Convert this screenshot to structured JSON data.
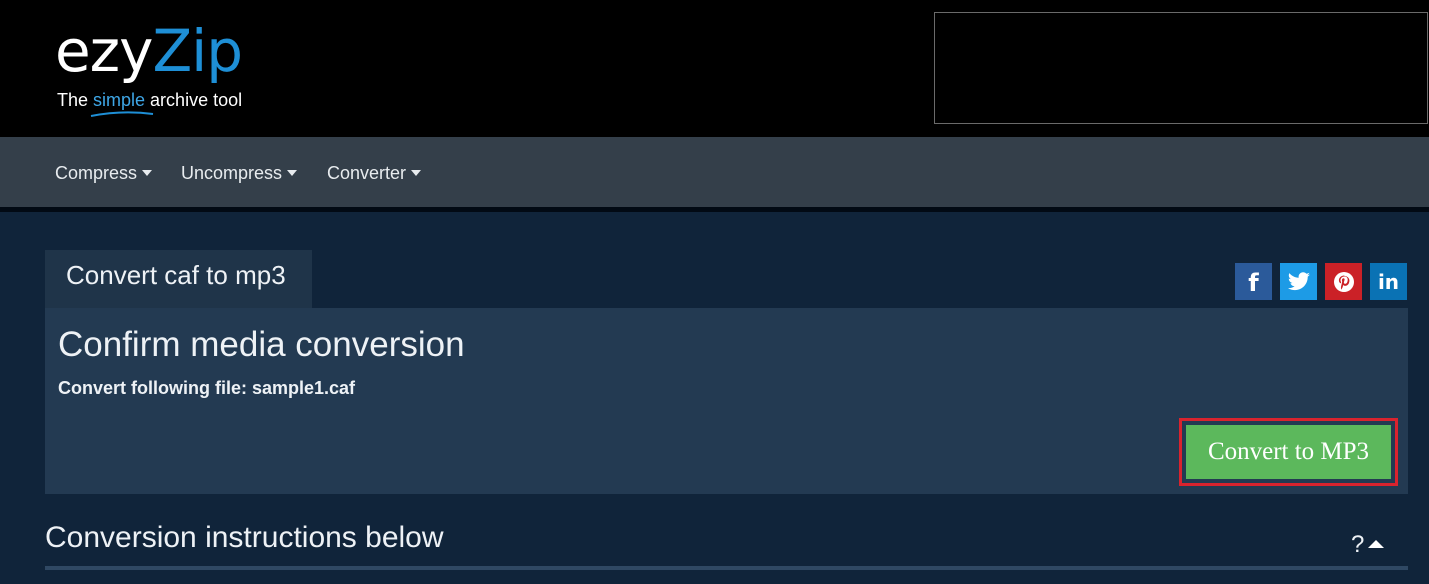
{
  "brand": {
    "logo_part1": "ezy",
    "logo_part2": "Zip",
    "tagline_before": "The ",
    "tagline_highlight": "simple",
    "tagline_after": " archive tool",
    "accent": "#1e8fd6"
  },
  "nav": {
    "items": [
      {
        "label": "Compress"
      },
      {
        "label": "Uncompress"
      },
      {
        "label": "Converter"
      }
    ]
  },
  "tab": {
    "label": "Convert caf to mp3"
  },
  "share": {
    "icons": [
      "facebook-icon",
      "twitter-icon",
      "pinterest-icon",
      "linkedin-icon"
    ],
    "colors": [
      "#2b5a9a",
      "#1d9be6",
      "#cb2127",
      "#0a72b4"
    ]
  },
  "panel": {
    "title": "Confirm media conversion",
    "subtitle": "Convert following file: sample1.caf",
    "button_label": "Convert to MP3",
    "button_color": "#5cb85c",
    "highlight_color": "#d9232e"
  },
  "instructions": {
    "heading": "Conversion instructions below",
    "help_label": "?"
  }
}
